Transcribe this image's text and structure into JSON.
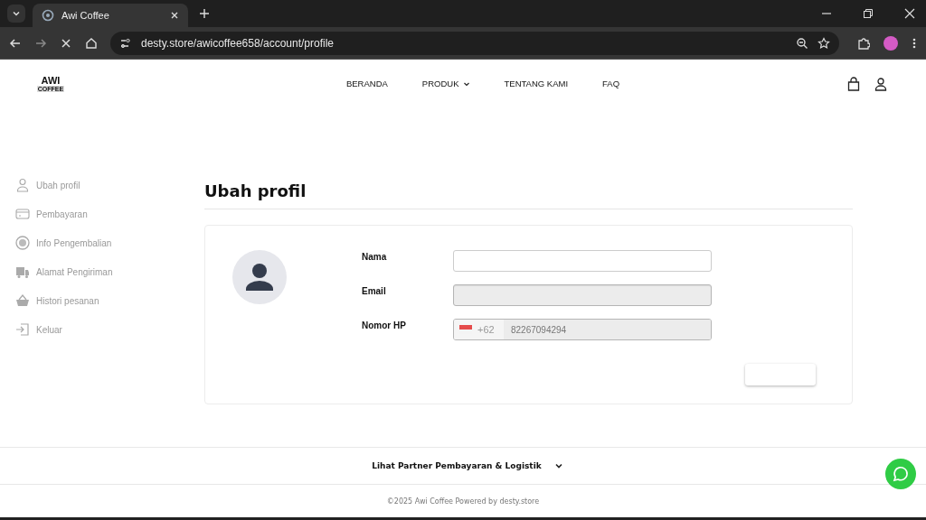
{
  "browser": {
    "tab_title": "Awi Coffee",
    "url": "desty.store/awicoffee658/account/profile"
  },
  "header": {
    "logo": {
      "line_1": "AWI",
      "line_2": "COFFEE"
    },
    "nav": [
      {
        "label": "BERANDA",
        "has_menu": false
      },
      {
        "label": "PRODUK",
        "has_menu": true
      },
      {
        "label": "TENTANG KAMI",
        "has_menu": false
      },
      {
        "label": "FAQ",
        "has_menu": false
      }
    ]
  },
  "sidebar": {
    "items": [
      {
        "label": "Ubah profil",
        "kind": "user"
      },
      {
        "label": "Pembayaran",
        "kind": "card"
      },
      {
        "label": "Info Pengembalian",
        "kind": "refund"
      },
      {
        "label": "Alamat Pengiriman",
        "kind": "truck"
      },
      {
        "label": "Histori pesanan",
        "kind": "basket"
      },
      {
        "label": "Keluar",
        "kind": "logout"
      }
    ]
  },
  "page_title": "Ubah profil",
  "form": {
    "fields": [
      {
        "label": "Nama",
        "kind": "text",
        "disabled": false
      },
      {
        "label": "Email",
        "kind": "text",
        "disabled": true
      },
      {
        "label": "Nomor HP",
        "kind": "phone",
        "disabled": true,
        "prefix": "+62",
        "value": "82267094294"
      }
    ]
  },
  "footer": {
    "partners": "Lihat Partner Pembayaran & Logistik",
    "copyright": "©2025 Awi Coffee Powered by desty.store"
  }
}
